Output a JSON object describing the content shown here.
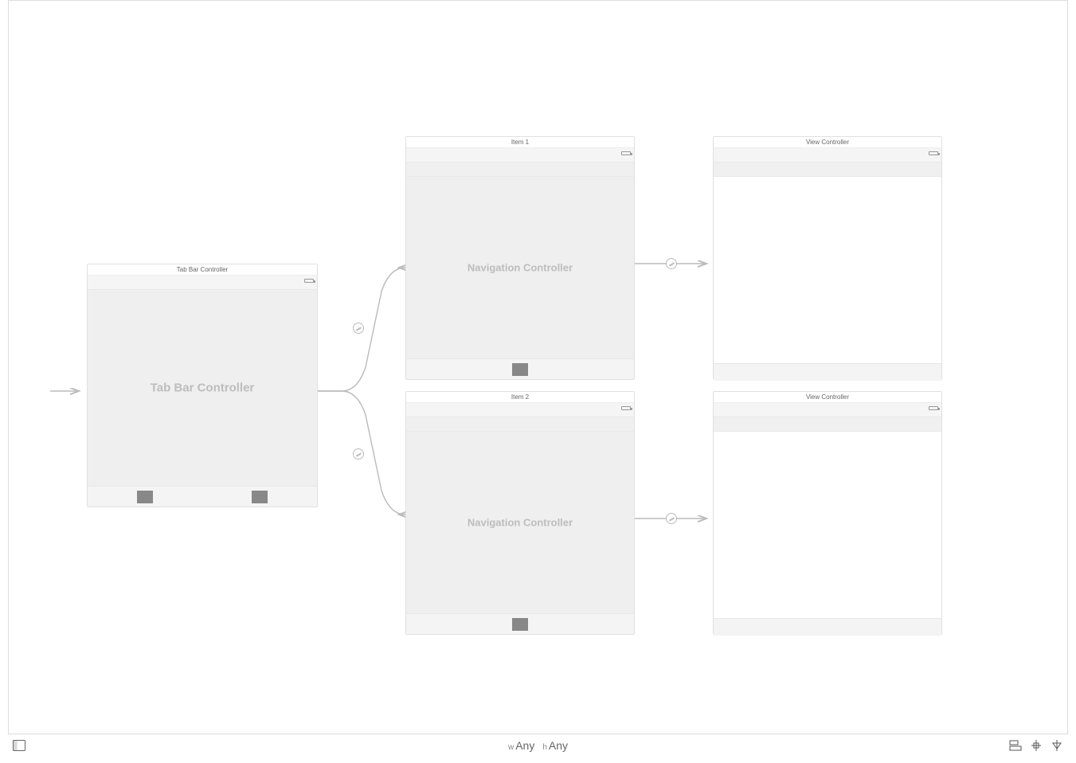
{
  "scenes": {
    "tabBar": {
      "title": "Tab Bar Controller",
      "placeholder": "Tab Bar Controller"
    },
    "nav1": {
      "title": "Item 1",
      "placeholder": "Navigation Controller"
    },
    "nav2": {
      "title": "Item 2",
      "placeholder": "Navigation Controller"
    },
    "vc1": {
      "title": "View Controller"
    },
    "vc2": {
      "title": "View Controller"
    }
  },
  "sizeClass": {
    "wLabel": "w",
    "wValue": "Any",
    "hLabel": "h",
    "hValue": "Any"
  }
}
